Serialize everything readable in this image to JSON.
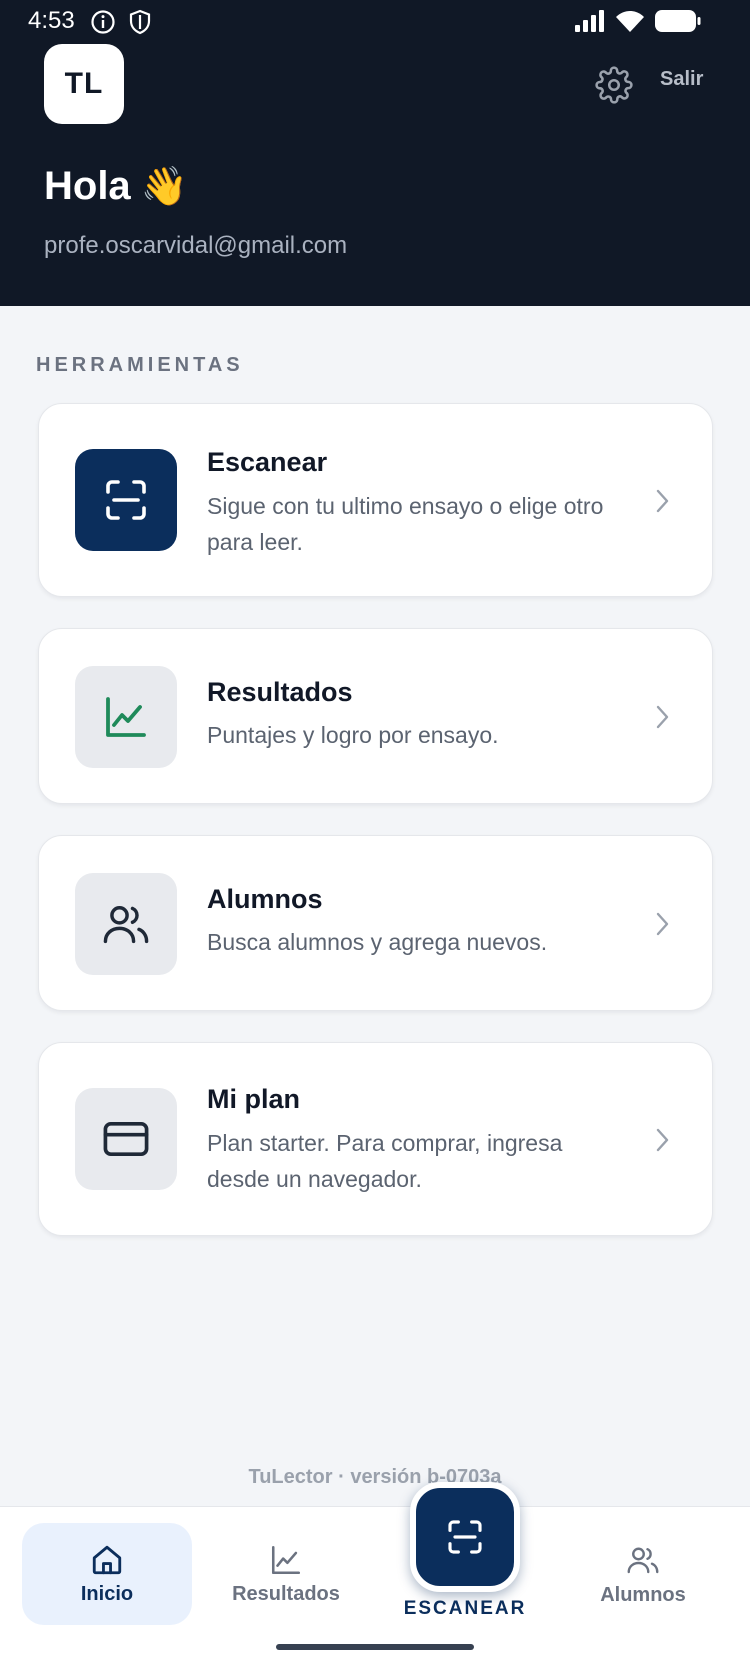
{
  "status": {
    "time": "4:53"
  },
  "header": {
    "avatar_initials": "TL",
    "logout_label": "Salir",
    "greeting": "Hola",
    "greeting_emoji": "👋",
    "email": "profe.oscarvidal@gmail.com"
  },
  "tools": {
    "section_title": "HERRAMIENTAS",
    "cards": [
      {
        "title": "Escanear",
        "description": "Sigue con tu ultimo ensayo o elige otro para leer.",
        "icon": "scan-icon"
      },
      {
        "title": "Resultados",
        "description": "Puntajes y logro por ensayo.",
        "icon": "chart-icon"
      },
      {
        "title": "Alumnos",
        "description": "Busca alumnos y agrega nuevos.",
        "icon": "users-icon"
      },
      {
        "title": "Mi plan",
        "description": "Plan starter. Para comprar, ingresa desde un navegador.",
        "icon": "card-icon"
      }
    ]
  },
  "footer": {
    "version": "TuLector · versión b-0703a"
  },
  "nav": {
    "items": [
      {
        "label": "Inicio",
        "icon": "home-icon"
      },
      {
        "label": "Resultados",
        "icon": "chart-icon"
      },
      {
        "label": "ESCANEAR",
        "icon": "scan-icon"
      },
      {
        "label": "Alumnos",
        "icon": "users-icon"
      }
    ]
  },
  "colors": {
    "header_bg": "#101826",
    "primary": "#0b2e5c",
    "success": "#1f8a5a",
    "page_bg": "#f3f5f8",
    "active_nav_bg": "#e9f1fd"
  }
}
